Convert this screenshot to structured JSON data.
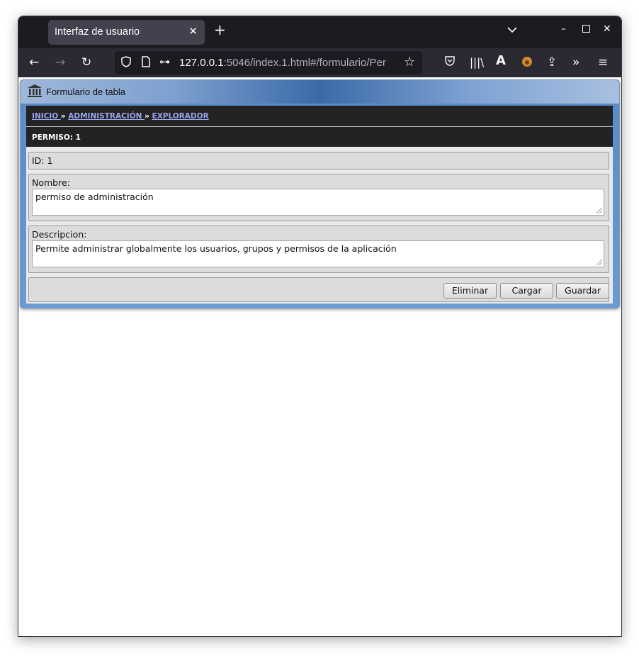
{
  "browser": {
    "tab_title": "Interfaz de usuario",
    "url_host": "127.0.0.1",
    "url_rest": ":5046/index.1.html#/formulario/Per"
  },
  "panel": {
    "title": "Formulario de tabla",
    "breadcrumb": [
      "INICIO ",
      "ADMINISTRACIÓN ",
      "EXPLORADOR"
    ],
    "breadcrumb_sep": " » ",
    "subtitle": "PERMISO: 1"
  },
  "form": {
    "id_label": "ID: 1",
    "nombre_label": "Nombre:",
    "nombre_value": "permiso de administración",
    "descripcion_label": "Descripcion:",
    "descripcion_value": "Permite administrar globalmente los usuarios, grupos y permisos de la aplicación"
  },
  "buttons": {
    "delete": "Eliminar",
    "load": "Cargar",
    "save": "Guardar"
  }
}
